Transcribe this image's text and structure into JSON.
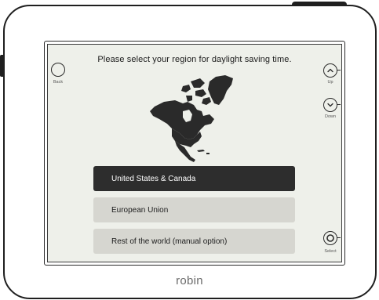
{
  "device": {
    "brand": "robin"
  },
  "screen": {
    "title": "Please select your region for daylight saving time.",
    "nav": {
      "back_label": "Back",
      "up_label": "Up",
      "down_label": "Down",
      "select_label": "Select"
    },
    "map_icon": "north-america-map",
    "options": [
      {
        "label": "United States & Canada",
        "selected": true
      },
      {
        "label": "European Union",
        "selected": false
      },
      {
        "label": "Rest of the world (manual option)",
        "selected": false
      }
    ]
  },
  "colors": {
    "screen_bg": "#eef0ea",
    "selected_bg": "#2d2d2d",
    "option_bg": "#d6d6d0"
  }
}
